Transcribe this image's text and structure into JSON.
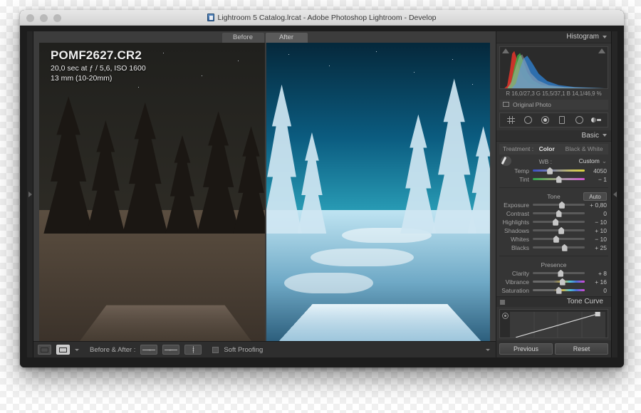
{
  "window": {
    "title": "Lightroom 5 Catalog.lrcat - Adobe Photoshop Lightroom - Develop",
    "title_icon": "lightroom-document-icon"
  },
  "image_view": {
    "before_tab": "Before",
    "after_tab": "After",
    "photo_info": {
      "filename": "POMF2627.CR2",
      "exposure_line": "20,0 sec at ƒ / 5,6, ISO 1600",
      "lens_line": "13 mm (10-20mm)"
    }
  },
  "toolbar": {
    "view_icon": "loupe-view-icon",
    "ba_view_icon": "before-after-view-icon",
    "dropdown_icon": "chevron-down-icon",
    "before_after_label": "Before & After :",
    "modes": [
      {
        "name": "copy-settings-after-to-before",
        "glyph": "→"
      },
      {
        "name": "copy-settings-before-to-after",
        "glyph": "←"
      },
      {
        "name": "swap-before-and-after",
        "glyph": "↕"
      }
    ],
    "soft_proofing_label": "Soft Proofing",
    "soft_proofing_checked": false,
    "right_toggle_icon": "chevron-down-icon"
  },
  "right_panel": {
    "histogram": {
      "title": "Histogram",
      "collapse_icon": "triangle-down-icon",
      "shadow_clip_icon": "shadow-clipping-indicator",
      "highlight_clip_icon": "highlight-clipping-indicator",
      "rgb_readout": "R 16,0/27,3   G 15,5/37,1   B 14,1/46,9 %",
      "original_photo_label": "Original Photo",
      "original_photo_icon": "rectangle-icon"
    },
    "tools": [
      {
        "name": "crop-overlay-tool",
        "icon": "crop-grid-icon"
      },
      {
        "name": "spot-removal-tool",
        "icon": "spot-removal-icon"
      },
      {
        "name": "red-eye-correction-tool",
        "icon": "red-eye-icon"
      },
      {
        "name": "graduated-filter-tool",
        "icon": "graduated-filter-icon"
      },
      {
        "name": "radial-filter-tool",
        "icon": "radial-filter-icon"
      },
      {
        "name": "adjustment-brush-tool",
        "icon": "adjustment-brush-icon"
      }
    ],
    "basic": {
      "title": "Basic",
      "collapse_icon": "triangle-down-icon",
      "treatment_label": "Treatment :",
      "treatment_color": "Color",
      "treatment_bw": "Black & White",
      "treatment_selected": "Color",
      "wb_label": "WB :",
      "wb_value": "Custom",
      "wb_dropdown_icon": "chevron-down-icon",
      "eyedropper_icon": "white-balance-selector-icon",
      "sliders": [
        {
          "label": "Temp",
          "value": "4050",
          "pos": 33,
          "track": "temp"
        },
        {
          "label": "Tint",
          "value": "− 1",
          "pos": 50,
          "track": "tint"
        }
      ],
      "tone_title": "Tone",
      "auto_label": "Auto",
      "tone_sliders": [
        {
          "label": "Exposure",
          "value": "+ 0,80",
          "pos": 56,
          "track": "plain"
        },
        {
          "label": "Contrast",
          "value": "0",
          "pos": 50,
          "track": "plain"
        },
        {
          "label": "Highlights",
          "value": "− 10",
          "pos": 44,
          "track": "plain"
        },
        {
          "label": "Shadows",
          "value": "+ 10",
          "pos": 55,
          "track": "plain"
        },
        {
          "label": "Whites",
          "value": "− 10",
          "pos": 45,
          "track": "plain"
        },
        {
          "label": "Blacks",
          "value": "+ 25",
          "pos": 61,
          "track": "plain"
        }
      ],
      "presence_title": "Presence",
      "presence_sliders": [
        {
          "label": "Clarity",
          "value": "+ 8",
          "pos": 54,
          "track": "plain"
        },
        {
          "label": "Vibrance",
          "value": "+ 16",
          "pos": 57,
          "track": "vib"
        },
        {
          "label": "Saturation",
          "value": "0",
          "pos": 50,
          "track": "sat"
        }
      ]
    },
    "tone_curve": {
      "title": "Tone Curve",
      "collapse_icon": "triangle-down-icon",
      "target_icon": "target-adjustment-icon"
    },
    "buttons": {
      "previous": "Previous",
      "reset": "Reset"
    }
  },
  "colors": {
    "panel_bg": "#353535",
    "app_bg": "#1d1d1d",
    "accent_text": "#c9c9c9"
  }
}
